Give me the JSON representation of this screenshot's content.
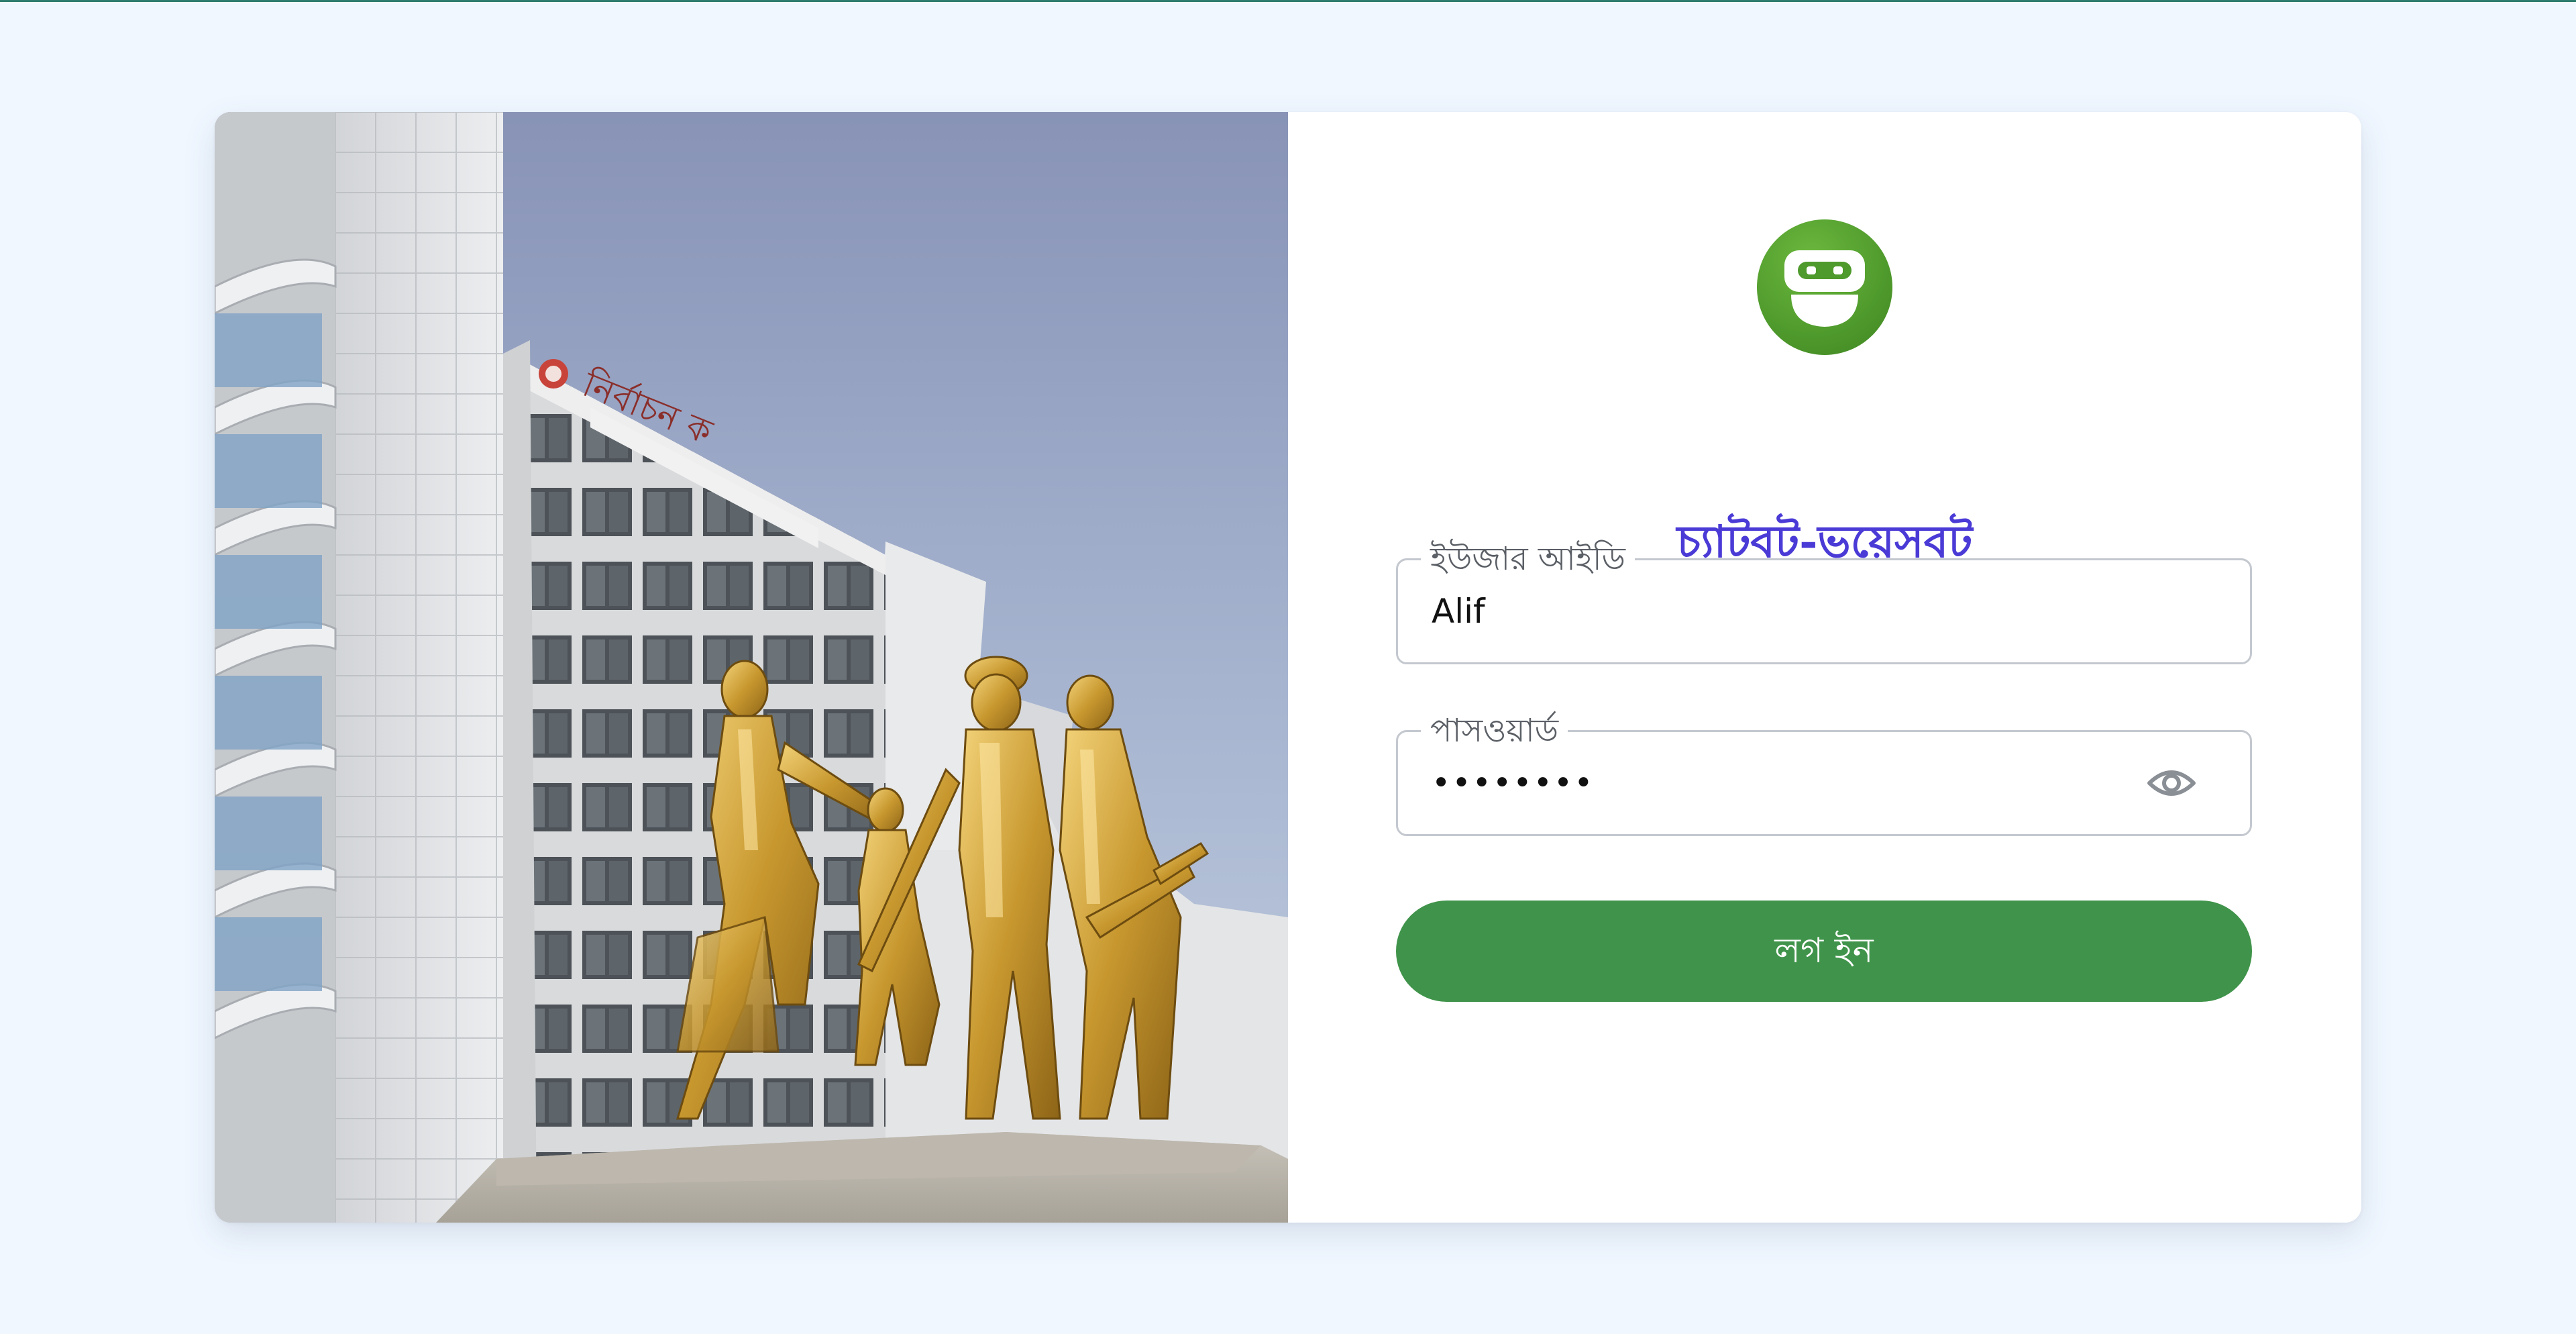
{
  "app": {
    "title": "চ্যাটবট-ভয়েসবট",
    "logo_icon": "robot-icon",
    "accent_color": "#4a3ad6",
    "brand_green": "#3f934a"
  },
  "form": {
    "username": {
      "label": "ইউজার আইডি",
      "value": "Alif"
    },
    "password": {
      "label": "পাসওয়ার্ড",
      "value": "••••••••",
      "toggle_icon": "eye-icon"
    },
    "login_button": {
      "label": "লগ ইন"
    }
  },
  "photo": {
    "building_sign": "নির্বাচন ক"
  }
}
